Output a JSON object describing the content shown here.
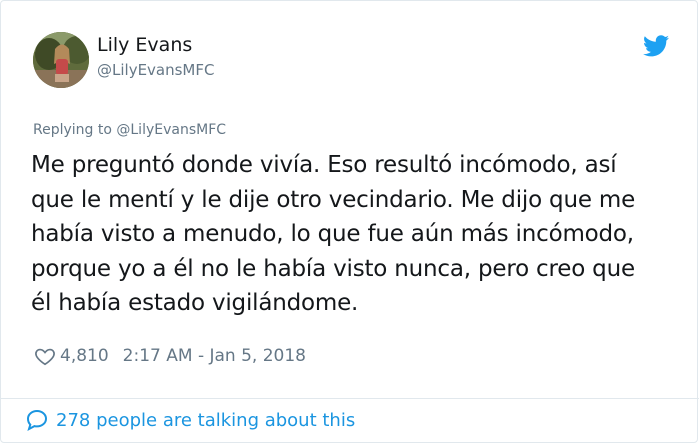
{
  "author": {
    "display_name": "Lily Evans",
    "handle": "@LilyEvansMFC"
  },
  "reply": {
    "text": "Replying to @LilyEvansMFC"
  },
  "tweet": {
    "lines": [
      "Me preguntó donde vivía. Eso resultó incómodo, así",
      "que le mentí y le dije otro vecindario. Me dijo que me",
      "había visto a menudo, lo que fue aún más incómodo,",
      "porque yo a él no le había visto nunca, pero creo que",
      "él había estado vigilándome."
    ]
  },
  "meta": {
    "likes": "4,810",
    "timestamp": "2:17 AM - Jan 5, 2018"
  },
  "footer": {
    "conversation": "278 people are talking about this"
  },
  "icons": {
    "brand": "twitter-bird-icon",
    "like": "heart-icon",
    "conversation": "speech-bubble-icon"
  },
  "colors": {
    "twitter_blue": "#1da1f2",
    "link_blue": "#1b95e0",
    "secondary_text": "#657786"
  }
}
